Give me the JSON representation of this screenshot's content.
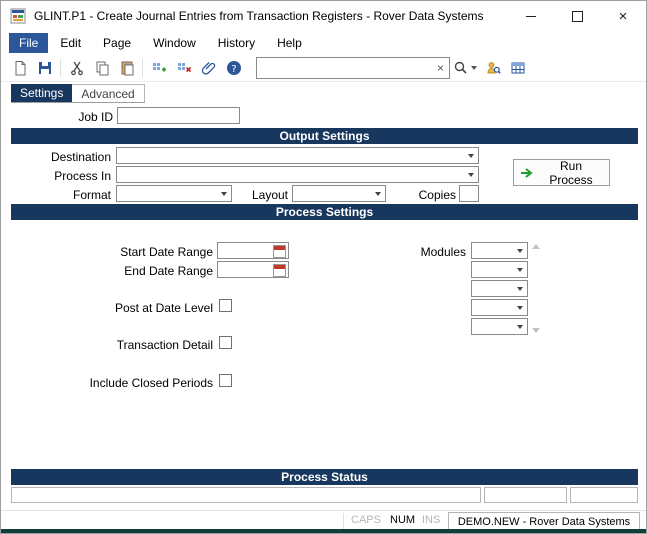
{
  "window": {
    "title": "GLINT.P1 - Create Journal Entries from Transaction Registers - Rover Data Systems",
    "close_glyph": "×"
  },
  "menu": {
    "items": [
      {
        "label": "File"
      },
      {
        "label": "Edit"
      },
      {
        "label": "Page"
      },
      {
        "label": "Window"
      },
      {
        "label": "History"
      },
      {
        "label": "Help"
      }
    ]
  },
  "toolbar": {
    "search_value": "",
    "clear_glyph": "×"
  },
  "tabs": {
    "settings": "Settings",
    "advanced": "Advanced"
  },
  "form": {
    "job_id": {
      "label": "Job ID",
      "value": ""
    },
    "output_settings": {
      "header": "Output Settings",
      "destination_label": "Destination",
      "process_in_label": "Process In",
      "format_label": "Format",
      "layout_label": "Layout",
      "copies_label": "Copies",
      "run_button_label": "Run Process"
    },
    "process_settings": {
      "header": "Process Settings",
      "start_date_label": "Start Date Range",
      "end_date_label": "End Date Range",
      "post_at_date_level_label": "Post at Date Level",
      "transaction_detail_label": "Transaction Detail",
      "include_closed_periods_label": "Include Closed Periods",
      "modules_label": "Modules"
    },
    "process_status": {
      "header": "Process Status",
      "cells": [
        "",
        "",
        ""
      ]
    }
  },
  "statusbar": {
    "caps": "CAPS",
    "num": "NUM",
    "ins": "INS",
    "connection": "DEMO.NEW - Rover Data Systems"
  },
  "colors": {
    "header_navy": "#17375e",
    "menu_highlight": "#2b579a",
    "accent_green": "#1f9d2f",
    "calendar_red": "#c0392b",
    "bottom_strip": "#0e3f3b"
  }
}
